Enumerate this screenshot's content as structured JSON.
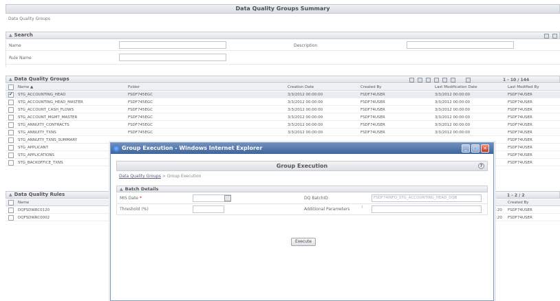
{
  "page": {
    "title": "Data Quality Groups Summary",
    "breadcrumb": "Data Quality Groups"
  },
  "search": {
    "heading": "Search",
    "name_label": "Name",
    "description_label": "Description",
    "rule_name_label": "Rule Name"
  },
  "groups": {
    "heading": "Data Quality Groups",
    "pager": "1 - 10 / 144",
    "columns": [
      "Name ▲",
      "Folder",
      "Creation Date",
      "Created By",
      "Last Modification Date",
      "Last Modified By"
    ],
    "rows": [
      {
        "checked": true,
        "name": "STG_ACCOUNTING_HEAD",
        "folder": "FSDF745EGC",
        "created": "3/3/2012 00:00:00",
        "by": "FSDF74USER",
        "modified": "3/3/2012 00:00:00",
        "mod_by": "FSDF74USER"
      },
      {
        "checked": false,
        "name": "STG_ACCOUNTING_HEAD_MASTER",
        "folder": "FSDF745EGC",
        "created": "3/3/2012 00:00:00",
        "by": "FSDF74USER",
        "modified": "3/3/2012 00:00:00",
        "mod_by": "FSDF74USER"
      },
      {
        "checked": false,
        "name": "STG_ACCOUNT_CASH_FLOWS",
        "folder": "FSDF745EGC",
        "created": "3/3/2012 00:00:00",
        "by": "FSDF74USER",
        "modified": "3/3/2012 00:00:00",
        "mod_by": "FSDF74USER"
      },
      {
        "checked": false,
        "name": "STG_ACCOUNT_MGMT_MASTER",
        "folder": "FSDF745EGC",
        "created": "3/3/2012 00:00:00",
        "by": "FSDF74USER",
        "modified": "3/3/2012 00:00:00",
        "mod_by": "FSDF74USER"
      },
      {
        "checked": false,
        "name": "STG_ANNUITY_CONTRACTS",
        "folder": "FSDF745EGC",
        "created": "3/3/2012 00:00:00",
        "by": "FSDF74USER",
        "modified": "3/3/2012 00:00:00",
        "mod_by": "FSDF74USER"
      },
      {
        "checked": false,
        "name": "STG_ANNUITY_TXNS",
        "folder": "FSDF745EGC",
        "created": "3/3/2012 00:00:00",
        "by": "FSDF74USER",
        "modified": "3/3/2012 00:00:00",
        "mod_by": "FSDF74USER"
      },
      {
        "checked": false,
        "name": "STG_ANNUITY_TXNS_SUMMARY",
        "folder": "",
        "created": "",
        "by": "",
        "modified": "",
        "mod_by": "FSDF74USER"
      },
      {
        "checked": false,
        "name": "STG_APPLICANT",
        "folder": "",
        "created": "",
        "by": "",
        "modified": "",
        "mod_by": "FSDF74USER"
      },
      {
        "checked": false,
        "name": "STG_APPLICATIONS",
        "folder": "",
        "created": "",
        "by": "",
        "modified": "",
        "mod_by": "FSDF74USER"
      },
      {
        "checked": false,
        "name": "STG_BACKOFFICE_TXNS",
        "folder": "",
        "created": "",
        "by": "",
        "modified": "",
        "mod_by": "FSDF74USER"
      }
    ]
  },
  "rules": {
    "heading": "Data Quality Rules",
    "pager": "1 - 2 / 2",
    "columns": [
      "Name",
      "Created By"
    ],
    "rows": [
      {
        "name": "DQFSDWRC0120",
        "time": "16:20",
        "by": "FSDF74USER"
      },
      {
        "name": "DQFSDWRC0002",
        "time": "16:20",
        "by": "FSDF74USER"
      }
    ]
  },
  "modal": {
    "window_title": "Group Execution - Windows Internet Explorer",
    "heading": "Group Execution",
    "crumb_link": "Data Quality Groups",
    "crumb_sep": " > ",
    "crumb_current": "Group Execution",
    "batch_heading": "Batch Details",
    "mis_date_label": "MIS Date",
    "dq_batch_label": "DQ BatchID",
    "dq_batch_value": "FSDF74INFO_STG_ACCOUNTING_HEAD_DQB",
    "threshold_label": "Threshold (%)",
    "additional_label": "Additional Parameters",
    "execute_label": "Execute"
  }
}
